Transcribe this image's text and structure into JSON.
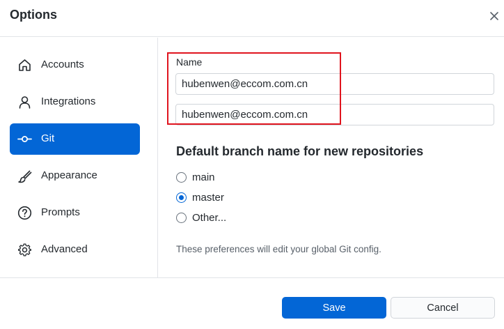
{
  "window": {
    "title": "Options"
  },
  "sidebar": {
    "items": [
      {
        "label": "Accounts",
        "icon": "home-icon",
        "active": false
      },
      {
        "label": "Integrations",
        "icon": "person-icon",
        "active": false
      },
      {
        "label": "Git",
        "icon": "git-commit-icon",
        "active": true
      },
      {
        "label": "Appearance",
        "icon": "paintbrush-icon",
        "active": false
      },
      {
        "label": "Prompts",
        "icon": "question-icon",
        "active": false
      },
      {
        "label": "Advanced",
        "icon": "gear-icon",
        "active": false
      }
    ]
  },
  "git": {
    "name_label": "Name",
    "name_value": "hubenwen@eccom.com.cn",
    "email_value": "hubenwen@eccom.com.cn",
    "branch_heading": "Default branch name for new repositories",
    "branch_options": [
      {
        "label": "main",
        "checked": false
      },
      {
        "label": "master",
        "checked": true
      },
      {
        "label": "Other...",
        "checked": false
      }
    ],
    "hint": "These preferences will edit your global Git config."
  },
  "footer": {
    "save_label": "Save",
    "cancel_label": "Cancel"
  },
  "colors": {
    "accent": "#0366d6",
    "highlight": "#e0141e"
  }
}
